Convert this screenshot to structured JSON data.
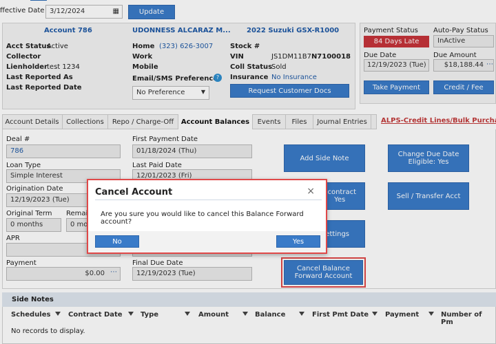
{
  "filter_bar": {
    "effective_date_label": "ffective Date",
    "effective_date_value": "3/12/2024",
    "update_label": "Update"
  },
  "account": {
    "title": "Account 786",
    "acct_status_label": "Acct Status",
    "acct_status_value": "Active",
    "collector_label": "Collector",
    "lienholder_label": "Lienholder",
    "lienholder_value": "test 1234",
    "last_reported_as_label": "Last Reported As",
    "last_reported_date_label": "Last Reported Date"
  },
  "customer": {
    "name": "UDONNESS ALCARAZ M...",
    "home_label": "Home",
    "home_value": "(323) 626-3007",
    "work_label": "Work",
    "mobile_label": "Mobile",
    "email_pref_label": "Email/SMS Preference",
    "email_pref_value": "No Preference"
  },
  "vehicle": {
    "title": "2022 Suzuki GSX-R1000",
    "stock_label": "Stock #",
    "vin_label": "VIN",
    "vin_value_prefix": "JS1DM11B7",
    "vin_value_bold": "N7100018",
    "coll_status_label": "Coll Status",
    "coll_status_value": "Sold",
    "insurance_label": "Insurance",
    "insurance_value": "No Insurance",
    "request_docs_label": "Request Customer Docs"
  },
  "payment_box": {
    "payment_status_label": "Payment Status",
    "payment_status_value": "84 Days Late",
    "autopay_label": "Auto-Pay Status",
    "autopay_value": "InActive",
    "due_date_label": "Due Date",
    "due_date_value": "12/19/2023 (Tue)",
    "due_amount_label": "Due Amount",
    "due_amount_value": "$18,188.44",
    "take_payment_label": "Take Payment",
    "credit_fee_label": "Credit / Fee"
  },
  "tabs": [
    {
      "label": "Account Details"
    },
    {
      "label": "Collections"
    },
    {
      "label": "Repo / Charge-Off"
    },
    {
      "label": "Account Balances"
    },
    {
      "label": "Events"
    },
    {
      "label": "Files"
    },
    {
      "label": "Journal Entries"
    }
  ],
  "alps_link": "ALPS-Credit Lines/Bulk Purchas",
  "balances": {
    "deal_label": "Deal #",
    "deal_value": "786",
    "loan_type_label": "Loan Type",
    "loan_type_value": "Simple Interest",
    "origination_label": "Origination Date",
    "origination_value": "12/19/2023 (Tue)",
    "original_term_label": "Original Term",
    "original_term_value": "0 months",
    "remaining_label": "Remai",
    "remaining_value": "0 mo",
    "apr_label": "APR",
    "payment_label": "Payment",
    "payment_value": "$0.00",
    "first_payment_label": "First Payment Date",
    "first_payment_value": "01/18/2024 (Thu)",
    "last_paid_label": "Last Paid Date",
    "last_paid_value": "12/01/2023 (Fri)",
    "final_due_label": "Final Due Date",
    "final_due_value": "12/19/2023 (Tue)"
  },
  "actions": {
    "add_side_note": "Add Side Note",
    "change_due_date": "Change Due Date\nEligible: Yes",
    "recontract": "econtract\nYes",
    "sell_transfer": "Sell / Transfer Acct",
    "settings": "ettings",
    "cancel_balance": "Cancel Balance\nForward Account"
  },
  "side_notes": {
    "title": "Side Notes",
    "columns": [
      "Schedules",
      "Contract Date",
      "Type",
      "Amount",
      "Balance",
      "First Pmt Date",
      "Payment",
      "Number of Pm"
    ],
    "empty_text": "No records to display."
  },
  "modal": {
    "title": "Cancel Account",
    "close": "×",
    "message": "Are you sure you would like to cancel this Balance Forward account?",
    "no_label": "No",
    "yes_label": "Yes"
  }
}
